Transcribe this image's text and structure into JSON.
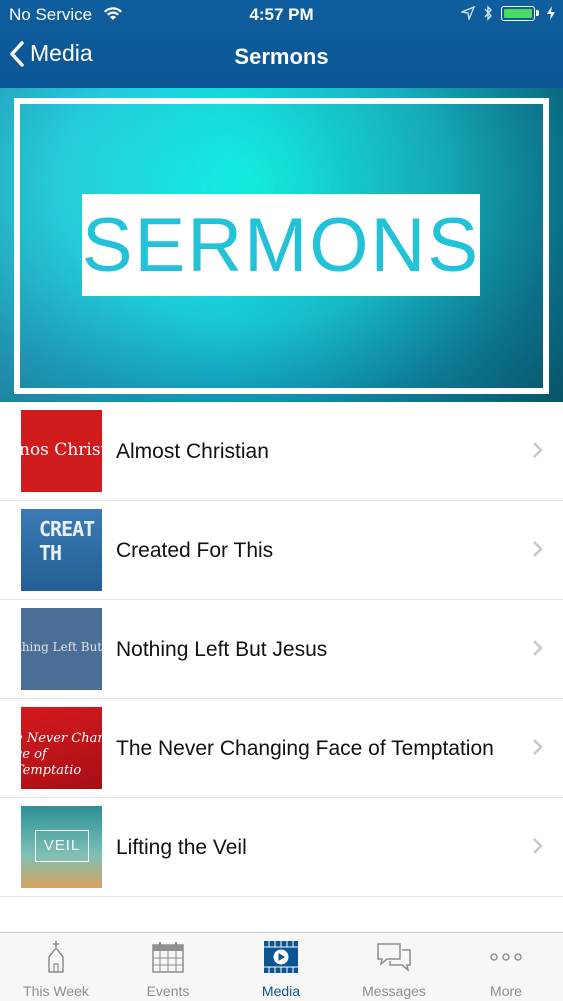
{
  "status_bar": {
    "carrier": "No Service",
    "time": "4:57 PM"
  },
  "nav": {
    "back_label": "Media",
    "title": "Sermons"
  },
  "hero": {
    "label": "SERMONS"
  },
  "sermons": [
    {
      "title": "Almost Christian",
      "thumb_text": "nos Christi",
      "thumb_color": "#d01c1c"
    },
    {
      "title": "Created For This",
      "thumb_text": "CREAT F TH",
      "thumb_color": "#2f6fa8"
    },
    {
      "title": "Nothing Left But Jesus",
      "thumb_text": "thing Left But Jes",
      "thumb_color": "#4a6e95"
    },
    {
      "title": "The Never Changing Face of Temptation",
      "thumb_text": "e Never Chang ce of Temptatio",
      "thumb_color": "#c3161a"
    },
    {
      "title": "Lifting the Veil",
      "thumb_text": "VEIL",
      "thumb_color": "#3b9e9b"
    }
  ],
  "tabs": [
    {
      "label": "This Week",
      "icon": "church-icon"
    },
    {
      "label": "Events",
      "icon": "calendar-icon"
    },
    {
      "label": "Media",
      "icon": "media-icon",
      "active": true
    },
    {
      "label": "Messages",
      "icon": "messages-icon"
    },
    {
      "label": "More",
      "icon": "more-icon"
    }
  ],
  "colors": {
    "nav_blue": "#0b5593",
    "accent": "#22c2d8"
  }
}
